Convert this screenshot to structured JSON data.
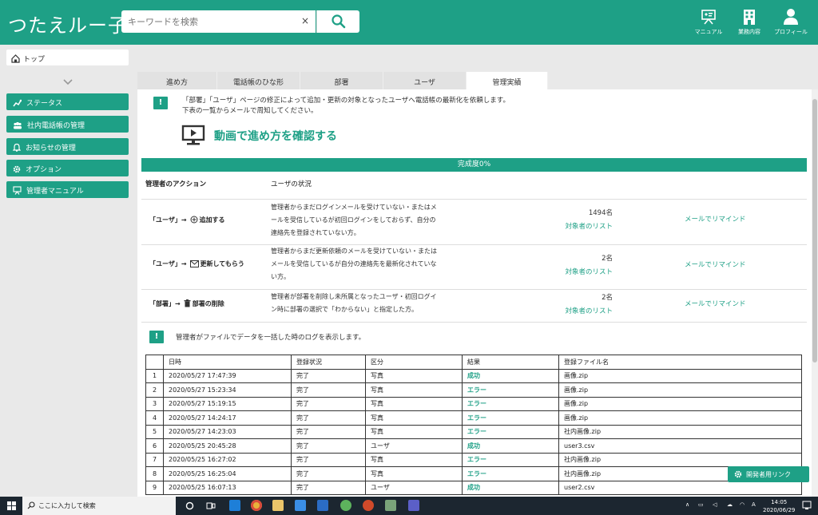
{
  "header": {
    "logo": "つたえルー子",
    "search_placeholder": "キーワードを検索",
    "clear": "×",
    "buttons": [
      {
        "label": "マニュアル",
        "icon": "presentation-icon"
      },
      {
        "label": "業務内容",
        "icon": "building-icon"
      },
      {
        "label": "プロフィール",
        "icon": "person-icon"
      }
    ]
  },
  "sidebar": {
    "breadcrumb": "トップ",
    "items": [
      {
        "label": "ステータス",
        "icon": "chart-icon"
      },
      {
        "label": "社内電話帳の管理",
        "icon": "people-icon"
      },
      {
        "label": "お知らせの管理",
        "icon": "bell-icon"
      },
      {
        "label": "オプション",
        "icon": "gear-icon"
      },
      {
        "label": "管理者マニュアル",
        "icon": "presentation-icon"
      }
    ]
  },
  "tabs": [
    "進め方",
    "電話帳のひな形",
    "部署",
    "ユーザ",
    "管理実績"
  ],
  "main": {
    "notice1_line1": "「部署」「ユーザ」ページの修正によって追加・更新の対象となったユーザへ電話帳の最新化を依頼します。",
    "notice1_line2": "下表の一覧からメールで周知してください。",
    "video_link": "動画で進め方を確認する",
    "progress": "完成度0%",
    "col_action": "管理者のアクション",
    "col_status": "ユーザの状況",
    "actions": [
      {
        "target": "「ユーザ」→",
        "verb": "追加する",
        "desc1": "管理者からまだログインメールを受けていない・またはメ",
        "desc2": "ールを受信しているが初回ログインをしておらず、自分の",
        "desc3": "連絡先を登録されていない方。",
        "count": "1494名",
        "list": "対象者のリスト",
        "remind": "メールでリマインド"
      },
      {
        "target": "「ユーザ」→",
        "verb": "更新してもらう",
        "desc1": "管理者からまだ更新依頼のメールを受けていない・または",
        "desc2": "メールを受信しているが自分の連絡先を最新化されていな",
        "desc3": "い方。",
        "count": "2名",
        "list": "対象者のリスト",
        "remind": "メールでリマインド"
      },
      {
        "target": "「部署」→",
        "verb": "部署の削除",
        "desc1": "管理者が部署を削除し未所属となったユーザ・初回ログイ",
        "desc2": "ン時に部署の選択で「わからない」と指定した方。",
        "count": "2名",
        "list": "対象者のリスト",
        "remind": "メールでリマインド"
      }
    ],
    "notice2": "管理者がファイルでデータを一括した時のログを表示します。",
    "log_headers": [
      "",
      "日時",
      "登録状況",
      "区分",
      "結果",
      "登録ファイル名"
    ],
    "log_rows": [
      [
        "1",
        "2020/05/27 17:47:39",
        "完了",
        "写真",
        "成功",
        "画像.zip"
      ],
      [
        "2",
        "2020/05/27 15:23:34",
        "完了",
        "写真",
        "エラー",
        "画像.zip"
      ],
      [
        "3",
        "2020/05/27 15:19:15",
        "完了",
        "写真",
        "エラー",
        "画像.zip"
      ],
      [
        "4",
        "2020/05/27 14:24:17",
        "完了",
        "写真",
        "エラー",
        "画像.zip"
      ],
      [
        "5",
        "2020/05/27 14:23:03",
        "完了",
        "写真",
        "エラー",
        "社内画像.zip"
      ],
      [
        "6",
        "2020/05/25 20:45:28",
        "完了",
        "ユーザ",
        "成功",
        "user3.csv"
      ],
      [
        "7",
        "2020/05/25 16:27:02",
        "完了",
        "写真",
        "エラー",
        "社内画像.zip"
      ],
      [
        "8",
        "2020/05/25 16:25:04",
        "完了",
        "写真",
        "エラー",
        "社内画像.zip"
      ],
      [
        "9",
        "2020/05/25 16:07:13",
        "完了",
        "ユーザ",
        "成功",
        "user2.csv"
      ]
    ],
    "dev_link": "開発者用リンク"
  },
  "taskbar": {
    "search": "ここに入力して検索",
    "time": "14:05",
    "date": "2020/06/29",
    "ime": "A"
  },
  "colors": {
    "accent": "#1ea086"
  }
}
